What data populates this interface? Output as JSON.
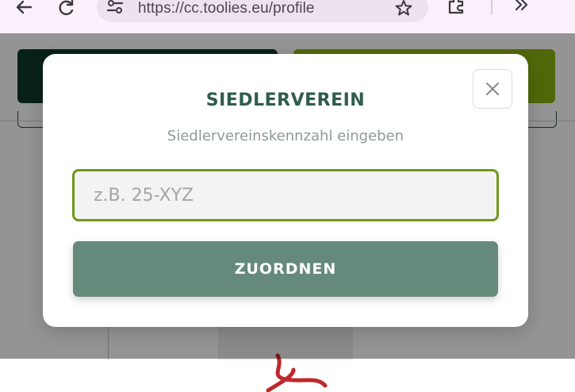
{
  "browser": {
    "url": "https://cc.toolies.eu/profile"
  },
  "icons": {
    "back": "arrow-left-icon",
    "reload": "reload-icon",
    "site_settings": "tune-icon",
    "bookmark": "star-icon",
    "extensions": "puzzle-icon",
    "more": "chevron-double-right-icon",
    "close": "close-icon"
  },
  "colors": {
    "title": "#2f5c4a",
    "input_border": "#6e9a1a",
    "button": "#658a7c",
    "page_btn_dark": "#0d3a2c",
    "page_btn_green": "#8cb412"
  },
  "modal": {
    "title": "SIEDLERVEREIN",
    "subtitle": "Siedlervereinskennzahl eingeben",
    "input_placeholder": "z.B. 25-XYZ",
    "input_value": "",
    "submit_label": "ZUORDNEN"
  }
}
